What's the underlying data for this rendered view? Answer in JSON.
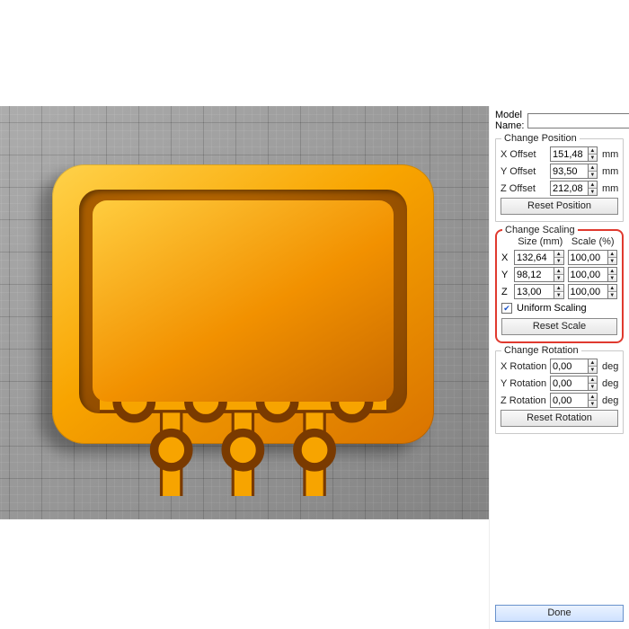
{
  "modelName": {
    "label": "Model Name:",
    "value": ""
  },
  "position": {
    "title": "Change Position",
    "x": {
      "label": "X Offset",
      "value": "151,48",
      "unit": "mm"
    },
    "y": {
      "label": "Y Offset",
      "value": "93,50",
      "unit": "mm"
    },
    "z": {
      "label": "Z Offset",
      "value": "212,08",
      "unit": "mm"
    },
    "reset": "Reset Position"
  },
  "scaling": {
    "title": "Change Scaling",
    "headers": {
      "size": "Size (mm)",
      "scale": "Scale (%)"
    },
    "x": {
      "axis": "X",
      "size": "132,64",
      "scale": "100,00"
    },
    "y": {
      "axis": "Y",
      "size": "98,12",
      "scale": "100,00"
    },
    "z": {
      "axis": "Z",
      "size": "13,00",
      "scale": "100,00"
    },
    "uniform": {
      "label": "Uniform Scaling",
      "checked": true
    },
    "reset": "Reset Scale"
  },
  "rotation": {
    "title": "Change Rotation",
    "x": {
      "label": "X Rotation",
      "value": "0,00",
      "unit": "deg"
    },
    "y": {
      "label": "Y Rotation",
      "value": "0,00",
      "unit": "deg"
    },
    "z": {
      "label": "Z Rotation",
      "value": "0,00",
      "unit": "deg"
    },
    "reset": "Reset Rotation"
  },
  "done": "Done"
}
